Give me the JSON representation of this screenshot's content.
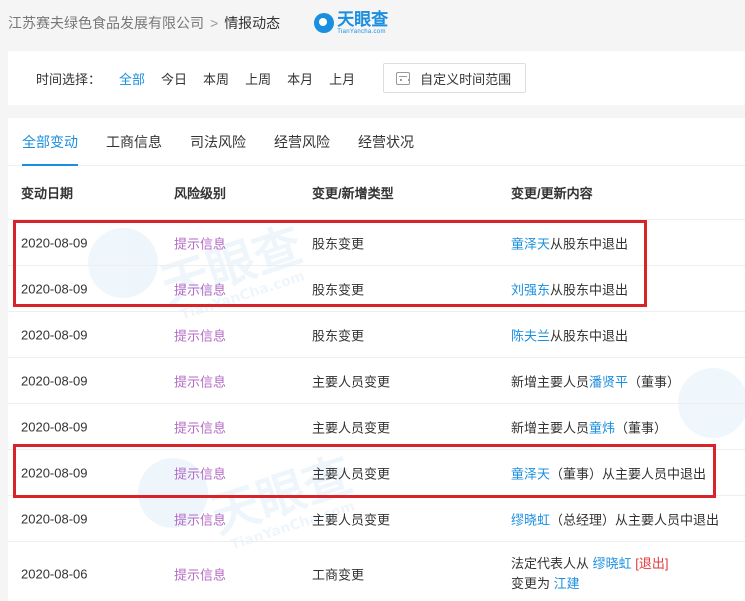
{
  "breadcrumb": {
    "company": "江苏赛夫绿色食品发展有限公司",
    "separator": ">",
    "current": "情报动态"
  },
  "logo": {
    "name": "天眼查",
    "domain": "TianYancha.com"
  },
  "filter": {
    "label": "时间选择：",
    "options": [
      "全部",
      "今日",
      "本周",
      "上周",
      "本月",
      "上月"
    ],
    "active": "全部",
    "custom_range_label": "自定义时间范围"
  },
  "tabs": {
    "items": [
      "全部变动",
      "工商信息",
      "司法风险",
      "经营风险",
      "经营状况"
    ],
    "active": "全部变动"
  },
  "table": {
    "headers": [
      "变动日期",
      "风险级别",
      "变更/新增类型",
      "变更/更新内容"
    ],
    "rows": [
      {
        "date": "2020-08-09",
        "risk": "提示信息",
        "type": "股东变更",
        "content": {
          "name": "童泽天",
          "text": "从股东中退出"
        }
      },
      {
        "date": "2020-08-09",
        "risk": "提示信息",
        "type": "股东变更",
        "content": {
          "name": "刘强东",
          "text": "从股东中退出"
        }
      },
      {
        "date": "2020-08-09",
        "risk": "提示信息",
        "type": "股东变更",
        "content": {
          "name": "陈夫兰",
          "text": "从股东中退出"
        }
      },
      {
        "date": "2020-08-09",
        "risk": "提示信息",
        "type": "主要人员变更",
        "content": {
          "prefix": "新增主要人员",
          "name": "潘贤平",
          "text": "（董事）"
        }
      },
      {
        "date": "2020-08-09",
        "risk": "提示信息",
        "type": "主要人员变更",
        "content": {
          "prefix": "新增主要人员",
          "name": "童炜",
          "text": "（董事）"
        }
      },
      {
        "date": "2020-08-09",
        "risk": "提示信息",
        "type": "主要人员变更",
        "content": {
          "name": "童泽天",
          "text": "（董事）从主要人员中退出"
        }
      },
      {
        "date": "2020-08-09",
        "risk": "提示信息",
        "type": "主要人员变更",
        "content": {
          "name": "缪晓虹",
          "text": "（总经理）从主要人员中退出"
        }
      },
      {
        "date": "2020-08-06",
        "risk": "提示信息",
        "type": "工商变更",
        "content": {
          "line1_prefix": "法定代表人从 ",
          "line1_name": "缪晓虹",
          "line1_tag": "[退出]",
          "line2_prefix": "变更为 ",
          "line2_name": "江建"
        }
      }
    ]
  },
  "colors": {
    "accent": "#1a8fe0",
    "risk": "#b36ac4",
    "highlight": "#d9232b",
    "exit_tag": "#e03a3a"
  }
}
